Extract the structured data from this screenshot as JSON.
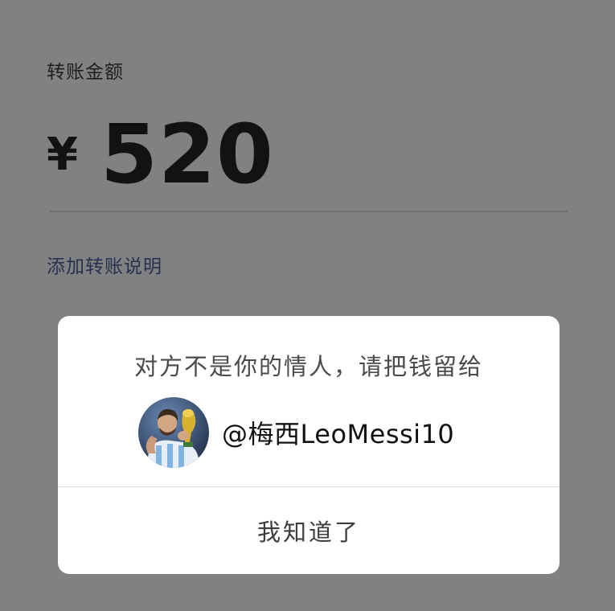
{
  "transfer": {
    "amount_label": "转账金额",
    "currency_symbol": "¥",
    "amount": "520",
    "add_note_link": "添加转账说明"
  },
  "dialog": {
    "message": "对方不是你的情人，请把钱留给",
    "recipient_name": "@梅西LeoMessi10",
    "confirm_button": "我知道了"
  },
  "colors": {
    "overlay_background": "#818082",
    "dialog_background": "#ffffff",
    "link_text": "#27304d"
  }
}
